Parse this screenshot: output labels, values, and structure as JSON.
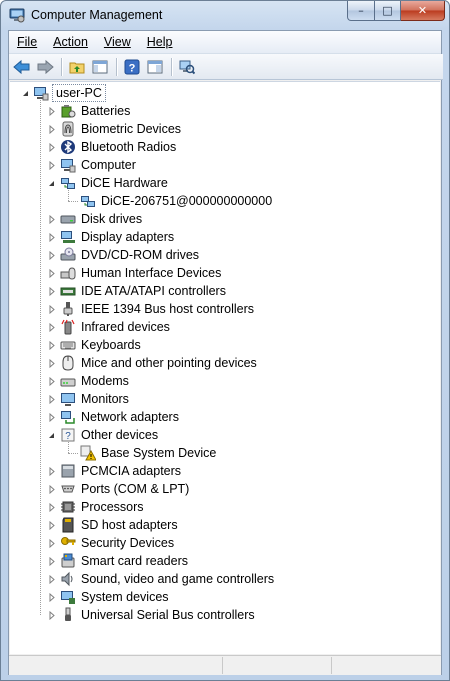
{
  "window": {
    "title": "Computer Management"
  },
  "caption": {
    "minimize": "–",
    "maximize": "□",
    "close": "✕"
  },
  "menu": [
    {
      "label": "File",
      "name": "menu-file"
    },
    {
      "label": "Action",
      "name": "menu-action"
    },
    {
      "label": "View",
      "name": "menu-view"
    },
    {
      "label": "Help",
      "name": "menu-help"
    }
  ],
  "toolbar": {
    "buttons": [
      "back-arrow-icon",
      "forward-arrow-icon",
      "up-folder-icon",
      "show-hide-tree-icon",
      "help-icon",
      "properties-icon",
      "scan-hardware-icon"
    ]
  },
  "tree": {
    "root": {
      "label": "user-PC",
      "icon": "computer-icon"
    },
    "items": [
      {
        "label": "Batteries",
        "icon": "battery-icon",
        "state": "collapsed"
      },
      {
        "label": "Biometric Devices",
        "icon": "fingerprint-icon",
        "state": "collapsed"
      },
      {
        "label": "Bluetooth Radios",
        "icon": "bluetooth-icon",
        "state": "collapsed"
      },
      {
        "label": "Computer",
        "icon": "computer-icon",
        "state": "collapsed"
      },
      {
        "label": "DiCE Hardware",
        "icon": "network-device-icon",
        "state": "expanded",
        "children": [
          {
            "label": "DiCE-206751@000000000000",
            "icon": "network-device-icon"
          }
        ]
      },
      {
        "label": "Disk drives",
        "icon": "disk-drive-icon",
        "state": "collapsed"
      },
      {
        "label": "Display adapters",
        "icon": "display-adapter-icon",
        "state": "collapsed"
      },
      {
        "label": "DVD/CD-ROM drives",
        "icon": "optical-drive-icon",
        "state": "collapsed"
      },
      {
        "label": "Human Interface Devices",
        "icon": "hid-icon",
        "state": "collapsed"
      },
      {
        "label": "IDE ATA/ATAPI controllers",
        "icon": "ide-controller-icon",
        "state": "collapsed"
      },
      {
        "label": "IEEE 1394 Bus host controllers",
        "icon": "firewire-icon",
        "state": "collapsed"
      },
      {
        "label": "Infrared devices",
        "icon": "infrared-icon",
        "state": "collapsed"
      },
      {
        "label": "Keyboards",
        "icon": "keyboard-icon",
        "state": "collapsed"
      },
      {
        "label": "Mice and other pointing devices",
        "icon": "mouse-icon",
        "state": "collapsed"
      },
      {
        "label": "Modems",
        "icon": "modem-icon",
        "state": "collapsed"
      },
      {
        "label": "Monitors",
        "icon": "monitor-icon",
        "state": "collapsed"
      },
      {
        "label": "Network adapters",
        "icon": "network-adapter-icon",
        "state": "collapsed"
      },
      {
        "label": "Other devices",
        "icon": "unknown-device-icon",
        "state": "expanded",
        "children": [
          {
            "label": "Base System Device",
            "icon": "warning-device-icon"
          }
        ]
      },
      {
        "label": "PCMCIA adapters",
        "icon": "pcmcia-icon",
        "state": "collapsed"
      },
      {
        "label": "Ports (COM & LPT)",
        "icon": "port-icon",
        "state": "collapsed"
      },
      {
        "label": "Processors",
        "icon": "processor-icon",
        "state": "collapsed"
      },
      {
        "label": "SD host adapters",
        "icon": "sd-card-icon",
        "state": "collapsed"
      },
      {
        "label": "Security Devices",
        "icon": "security-key-icon",
        "state": "collapsed"
      },
      {
        "label": "Smart card readers",
        "icon": "smart-card-reader-icon",
        "state": "collapsed"
      },
      {
        "label": "Sound, video and game controllers",
        "icon": "speaker-icon",
        "state": "collapsed"
      },
      {
        "label": "System devices",
        "icon": "system-device-icon",
        "state": "collapsed"
      },
      {
        "label": "Universal Serial Bus controllers",
        "icon": "usb-icon",
        "state": "collapsed"
      }
    ]
  },
  "colors": {
    "selection_border": "#7a8aa0",
    "accent": "#2b5797",
    "warning": "#f2c200"
  }
}
